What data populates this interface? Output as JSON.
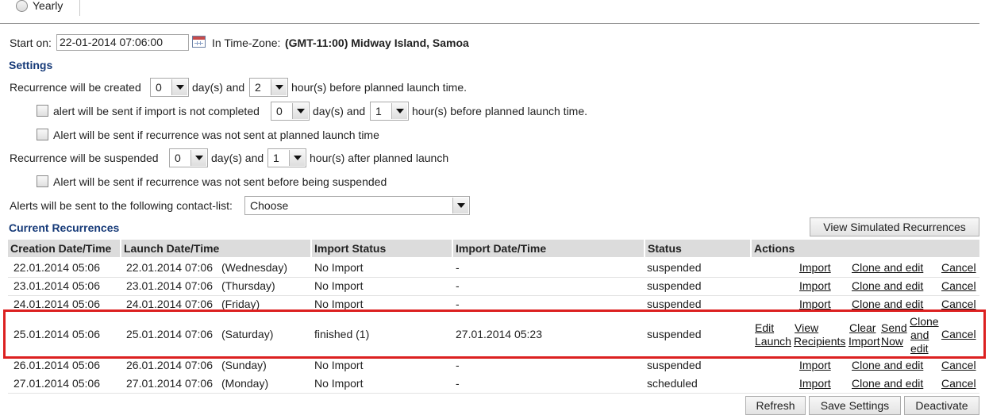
{
  "schedule": {
    "yearly_label": "Yearly"
  },
  "start": {
    "label": "Start on:",
    "value": "22-01-2014 07:06:00",
    "tz_label": "In Time-Zone:",
    "tz_value": "(GMT-11:00) Midway Island, Samoa"
  },
  "settings": {
    "heading": "Settings",
    "created_prefix": "Recurrence will be created",
    "created_days": "0",
    "days_and": "day(s) and",
    "created_hours": "2",
    "created_suffix": "hour(s) before planned launch time.",
    "alert_import_label": "alert will be sent if import is not completed",
    "alert_import_days": "0",
    "alert_import_days_and": "day(s) and",
    "alert_import_hours": "1",
    "alert_import_suffix": "hour(s) before planned launch time.",
    "alert_not_sent_label": "Alert will be sent if recurrence was not sent at planned launch time",
    "suspended_prefix": "Recurrence will be suspended",
    "suspended_days": "0",
    "suspended_days_and": "day(s) and",
    "suspended_hours": "1",
    "suspended_suffix": "hour(s) after planned launch",
    "alert_suspended_label": "Alert will be sent if recurrence was not sent before being suspended",
    "contact_label": "Alerts will be sent to the following contact-list:",
    "contact_value": "Choose"
  },
  "recurrences": {
    "heading": "Current Recurrences",
    "view_simulated": "View Simulated Recurrences",
    "columns": [
      "Creation Date/Time",
      "Launch Date/Time",
      "Import Status",
      "Import Date/Time",
      "Status",
      "Actions"
    ],
    "rows": [
      {
        "created": "22.01.2014 05:06",
        "launch": "22.01.2014 07:06",
        "day": "(Wednesday)",
        "import_status": "No Import",
        "import_date": "-",
        "status": "suspended"
      },
      {
        "created": "23.01.2014 05:06",
        "launch": "23.01.2014 07:06",
        "day": "(Thursday)",
        "import_status": "No Import",
        "import_date": "-",
        "status": "suspended"
      },
      {
        "created": "24.01.2014 05:06",
        "launch": "24.01.2014 07:06",
        "day": "(Friday)",
        "import_status": "No Import",
        "import_date": "-",
        "status": "suspended"
      },
      {
        "created": "25.01.2014 05:06",
        "launch": "25.01.2014 07:06",
        "day": "(Saturday)",
        "import_status": "finished (1)",
        "import_date": "27.01.2014 05:23",
        "status": "suspended"
      },
      {
        "created": "26.01.2014 05:06",
        "launch": "26.01.2014 07:06",
        "day": "(Sunday)",
        "import_status": "No Import",
        "import_date": "-",
        "status": "suspended"
      },
      {
        "created": "27.01.2014 05:06",
        "launch": "27.01.2014 07:06",
        "day": "(Monday)",
        "import_status": "No Import",
        "import_date": "-",
        "status": "scheduled"
      }
    ],
    "actions": {
      "import": "Import",
      "clone_edit": "Clone and edit",
      "cancel": "Cancel"
    },
    "row4_actions": {
      "edit": "Edit",
      "launch": "Launch",
      "view": "View",
      "recipients": "Recipients",
      "clear": "Clear",
      "import": "Import",
      "send": "Send",
      "now": "Now",
      "clone": "Clone",
      "and": "and",
      "edit2": "edit",
      "cancel": "Cancel"
    },
    "highlight_color": "#dc2020"
  },
  "footer": {
    "refresh": "Refresh",
    "save": "Save Settings",
    "deactivate": "Deactivate"
  }
}
